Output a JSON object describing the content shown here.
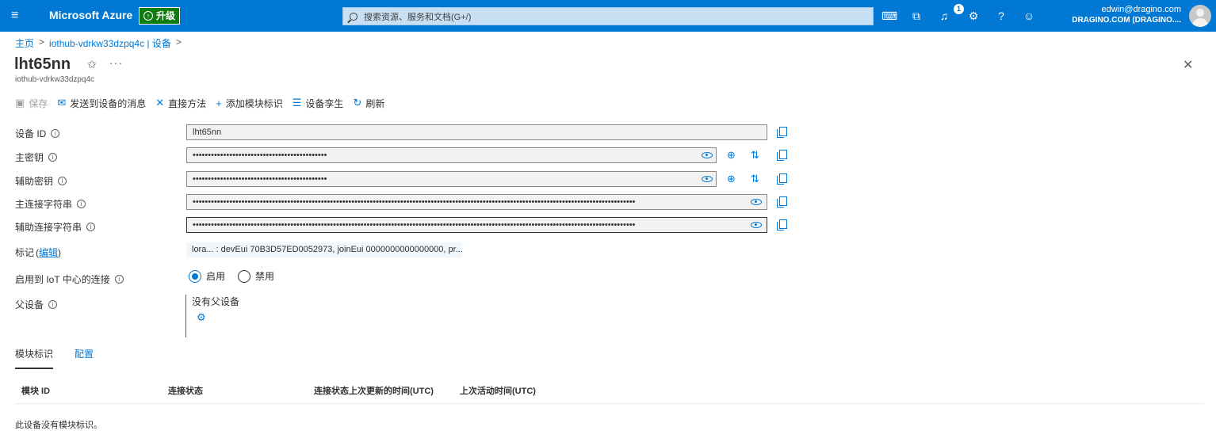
{
  "topbar": {
    "brand": "Microsoft Azure",
    "upgrade_label": "升级",
    "search_placeholder": "搜索资源、服务和文档(G+/)",
    "notification_count": "1",
    "account_email": "edwin@dragino.com",
    "account_org": "DRAGINO.COM (DRAGINO...."
  },
  "breadcrumb": {
    "home": "主页",
    "hub": "iothub-vdrkw33dzpq4c | 设备",
    "sep": ">"
  },
  "header": {
    "title": "lht65nn",
    "subtitle": "iothub-vdrkw33dzpq4c",
    "more": "···"
  },
  "toolbar": {
    "save": "保存",
    "send_message": "发送到设备的消息",
    "direct_method": "直接方法",
    "add_module": "添加模块标识",
    "device_twin": "设备孪生",
    "refresh": "刷新"
  },
  "form": {
    "device_id_label": "设备 ID",
    "device_id_value": "lht65nn",
    "primary_key_label": "主密钥",
    "primary_key_value": "••••••••••••••••••••••••••••••••••••••••••••",
    "secondary_key_label": "辅助密钥",
    "secondary_key_value": "••••••••••••••••••••••••••••••••••••••••••••",
    "primary_conn_label": "主连接字符串",
    "primary_conn_value": "•••••••••••••••••••••••••••••••••••••••••••••••••••••••••••••••••••••••••••••••••••••••••••••••••••••••••••••••••••••••••••••••••••••••••••••••••",
    "secondary_conn_label": "辅助连接字符串",
    "secondary_conn_value": "•••••••••••••••••••••••••••••••••••••••••••••••••••••••••••••••••••••••••••••••••••••••••••••••••••••••••••••••••••••••••••••••••••••••••••••••••",
    "tags_label": "标记",
    "tags_edit": "编辑",
    "tags_value": "lora...   : devEui 70B3D57ED0052973, joinEui 0000000000000000, pr...",
    "connection_label": "启用到 IoT 中心的连接",
    "enable_label": "启用",
    "disable_label": "禁用",
    "parent_label": "父设备",
    "parent_value": "没有父设备"
  },
  "tabs": {
    "module_identities": "模块标识",
    "configuration": "配置"
  },
  "table": {
    "col_module_id": "模块 ID",
    "col_conn_state": "连接状态",
    "col_conn_updated": "连接状态上次更新的时间(UTC)",
    "col_last_activity": "上次活动时间(UTC)",
    "empty_message": "此设备没有模块标识。"
  }
}
